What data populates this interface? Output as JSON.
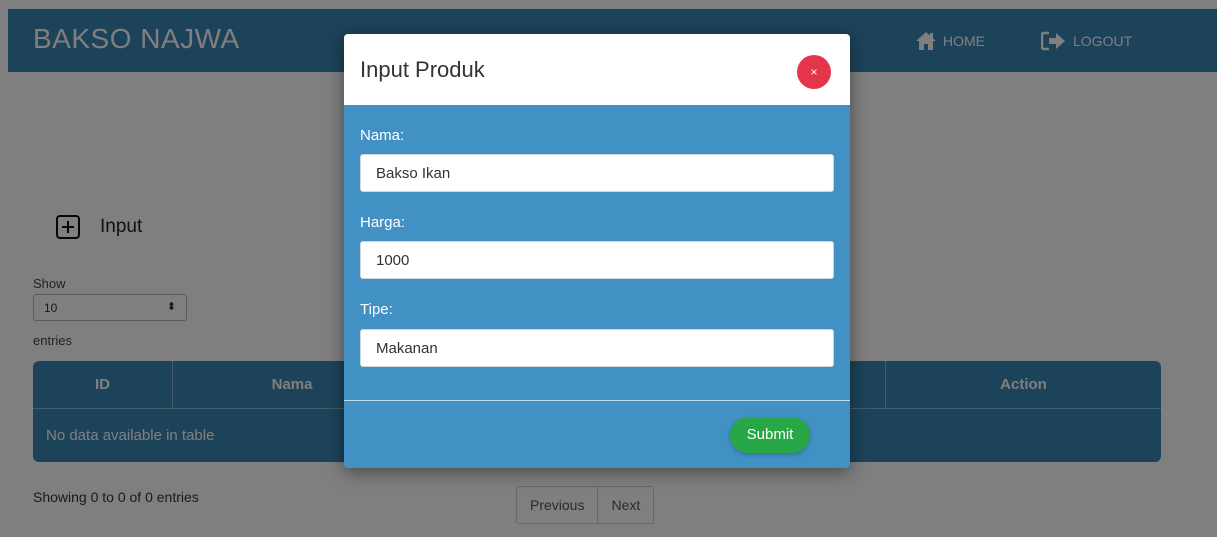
{
  "navbar": {
    "brand": "BAKSO NAJWA",
    "home_label": "HOME",
    "logout_label": "LOGOUT"
  },
  "toolbar": {
    "input_label": "Input"
  },
  "length_menu": {
    "show_label": "Show",
    "selected": "10",
    "entries_label": "entries"
  },
  "table": {
    "columns": [
      "ID",
      "Nama",
      "Action"
    ],
    "empty_message": "No data available in table",
    "info": "Showing 0 to 0 of 0 entries"
  },
  "pagination": {
    "previous": "Previous",
    "next": "Next"
  },
  "modal": {
    "title": "Input Produk",
    "close_label": "×",
    "fields": [
      {
        "label": "Nama:",
        "value": "Bakso Ikan"
      },
      {
        "label": "Harga:",
        "value": "1000"
      },
      {
        "label": "Tipe:",
        "value": "Makanan"
      }
    ],
    "submit_label": "Submit"
  },
  "colors": {
    "primary": "#3a86b4",
    "modal_body": "#4191c4",
    "close": "#e5354b",
    "submit": "#27a745"
  }
}
